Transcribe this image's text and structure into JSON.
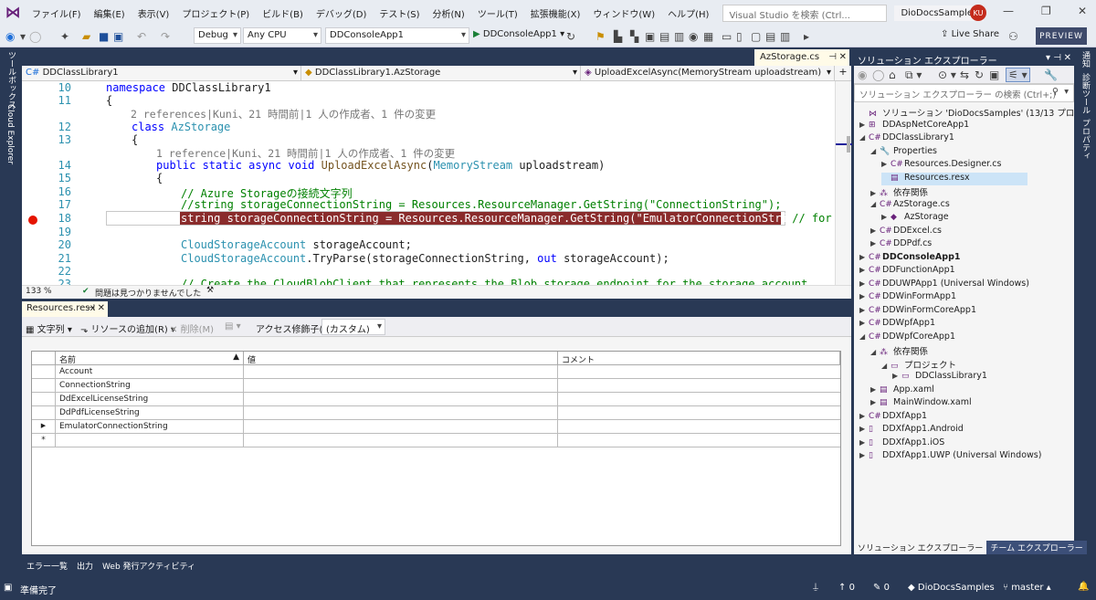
{
  "menubar": {
    "logo": "⋈",
    "items": [
      "ファイル(F)",
      "編集(E)",
      "表示(V)",
      "プロジェクト(P)",
      "ビルド(B)",
      "デバッグ(D)",
      "テスト(S)",
      "分析(N)",
      "ツール(T)",
      "拡張機能(X)",
      "ウィンドウ(W)",
      "ヘルプ(H)"
    ],
    "search_placeholder": "Visual Studio を検索 (Ctrl...",
    "solution_name": "DioDocsSamples",
    "avatar": "KU"
  },
  "toolbar": {
    "config": "Debug",
    "platform": "Any CPU",
    "startup": "DDConsoleApp1",
    "run_label": "DDConsoleApp1",
    "live_share": "Live Share",
    "preview": "PREVIEW"
  },
  "left_strip": [
    "ツールボックス",
    "Cloud Explorer"
  ],
  "right_strip": [
    "通知",
    "診断ツール",
    "プロパティ"
  ],
  "editor": {
    "tab": "AzStorage.cs",
    "nav": [
      "DDClassLibrary1",
      "DDClassLibrary1.AzStorage",
      "UploadExcelAsync(MemoryStream uploadstream)"
    ],
    "line_numbers": [
      "10",
      "11",
      "12",
      "13",
      "14",
      "15",
      "16",
      "17",
      "18",
      "19",
      "20",
      "21",
      "22",
      "23"
    ],
    "lens_class": "2 references|Kuni、21 時間前|1 人の作成者、1 件の変更",
    "lens_method": "1 reference|Kuni、21 時間前|1 人の作成者、1 件の変更",
    "code": {
      "l10_kw": "namespace",
      "l10_name": " DDClassLibrary1",
      "l11": "{",
      "l12_kw": "class",
      "l12_name": " AzStorage",
      "l13": "{",
      "l14_a": "public static async void",
      "l14_b": "UploadExcelAsync",
      "l14_c": "(",
      "l14_d": "MemoryStream",
      "l14_e": " uploadstream)",
      "l15": "{",
      "l16": "// Azure Storageの接続文字列",
      "l17": "//string storageConnectionString = Resources.ResourceManager.GetString(\"ConnectionString\");",
      "l18_a": "string storageConnectionString = Resources.ResourceManager.GetString(\"EmulatorConnectionString\");",
      "l18_b": " // for",
      "l20_a": "CloudStorageAccount",
      "l20_b": " storageAccount;",
      "l21_a": "CloudStorageAccount",
      "l21_b": ".TryParse(storageConnectionString, ",
      "l21_c": "out",
      "l21_d": " storageAccount);",
      "l23": "// Create the CloudBlobClient that represents the Blob storage endpoint for the storage account."
    },
    "zoom": "133 %",
    "status": "問題は見つかりませんでした"
  },
  "resources": {
    "tab": "Resources.resx",
    "toolbar": [
      "文字列",
      "リソースの追加(R)",
      "削除(M)",
      "アクセス修飾子(I):",
      "(カスタム)"
    ],
    "columns": [
      "名前",
      "値",
      "コメント"
    ],
    "rows": [
      {
        "marker": "",
        "name": "Account"
      },
      {
        "marker": "",
        "name": "ConnectionString"
      },
      {
        "marker": "",
        "name": "DdExcelLicenseString"
      },
      {
        "marker": "",
        "name": "DdPdfLicenseString"
      },
      {
        "marker": "▶",
        "name": "EmulatorConnectionString"
      },
      {
        "marker": "*",
        "name": ""
      }
    ]
  },
  "bottom_tabs": [
    "エラー一覧",
    "出力",
    "Web 発行アクティビティ"
  ],
  "solution_explorer": {
    "title": "ソリューション エクスプローラー",
    "search_placeholder": "ソリューション エクスプローラー の検索 (Ctrl+;)",
    "items": [
      {
        "level": 0,
        "exp": "",
        "icon": "⋈",
        "label": "ソリューション 'DioDocsSamples' (13/13 プロジェクト)"
      },
      {
        "level": 0,
        "exp": "▶",
        "icon": "⊞",
        "label": "DDAspNetCoreApp1"
      },
      {
        "level": 0,
        "exp": "◢",
        "icon": "C#",
        "label": "DDClassLibrary1"
      },
      {
        "level": 1,
        "exp": "◢",
        "icon": "🔧",
        "label": "Properties"
      },
      {
        "level": 2,
        "exp": "▶",
        "icon": "C#",
        "label": "Resources.Designer.cs"
      },
      {
        "level": 2,
        "exp": "",
        "icon": "▤",
        "label": "Resources.resx"
      },
      {
        "level": 1,
        "exp": "▶",
        "icon": "⁂",
        "label": "依存関係"
      },
      {
        "level": 1,
        "exp": "◢",
        "icon": "C#",
        "label": "AzStorage.cs"
      },
      {
        "level": 2,
        "exp": "▶",
        "icon": "◆",
        "label": "AzStorage"
      },
      {
        "level": 1,
        "exp": "▶",
        "icon": "C#",
        "label": "DDExcel.cs"
      },
      {
        "level": 1,
        "exp": "▶",
        "icon": "C#",
        "label": "DDPdf.cs"
      },
      {
        "level": 0,
        "exp": "▶",
        "icon": "C#",
        "label": "DDConsoleApp1",
        "bold": true
      },
      {
        "level": 0,
        "exp": "▶",
        "icon": "C#",
        "label": "DDFunctionApp1"
      },
      {
        "level": 0,
        "exp": "▶",
        "icon": "C#",
        "label": "DDUWPApp1 (Universal Windows)"
      },
      {
        "level": 0,
        "exp": "▶",
        "icon": "C#",
        "label": "DDWinFormApp1"
      },
      {
        "level": 0,
        "exp": "▶",
        "icon": "C#",
        "label": "DDWinFormCoreApp1"
      },
      {
        "level": 0,
        "exp": "▶",
        "icon": "C#",
        "label": "DDWpfApp1"
      },
      {
        "level": 0,
        "exp": "◢",
        "icon": "C#",
        "label": "DDWpfCoreApp1"
      },
      {
        "level": 1,
        "exp": "◢",
        "icon": "⁂",
        "label": "依存関係"
      },
      {
        "level": 2,
        "exp": "◢",
        "icon": "▭",
        "label": "プロジェクト"
      },
      {
        "level": 3,
        "exp": "▶",
        "icon": "▭",
        "label": "DDClassLibrary1"
      },
      {
        "level": 1,
        "exp": "▶",
        "icon": "▤",
        "label": "App.xaml"
      },
      {
        "level": 1,
        "exp": "▶",
        "icon": "▤",
        "label": "MainWindow.xaml"
      },
      {
        "level": 0,
        "exp": "▶",
        "icon": "C#",
        "label": "DDXfApp1"
      },
      {
        "level": 0,
        "exp": "▶",
        "icon": "▯",
        "label": "DDXfApp1.Android"
      },
      {
        "level": 0,
        "exp": "▶",
        "icon": "▯",
        "label": "DDXfApp1.iOS"
      },
      {
        "level": 0,
        "exp": "▶",
        "icon": "▯",
        "label": "DDXfApp1.UWP (Universal Windows)"
      }
    ],
    "tabs": [
      "ソリューション エクスプローラー",
      "チーム エクスプローラー"
    ]
  },
  "statusbar": {
    "ready": "準備完了",
    "up_count": "0",
    "edit_count": "0",
    "repo": "DioDocsSamples",
    "branch": "master"
  }
}
